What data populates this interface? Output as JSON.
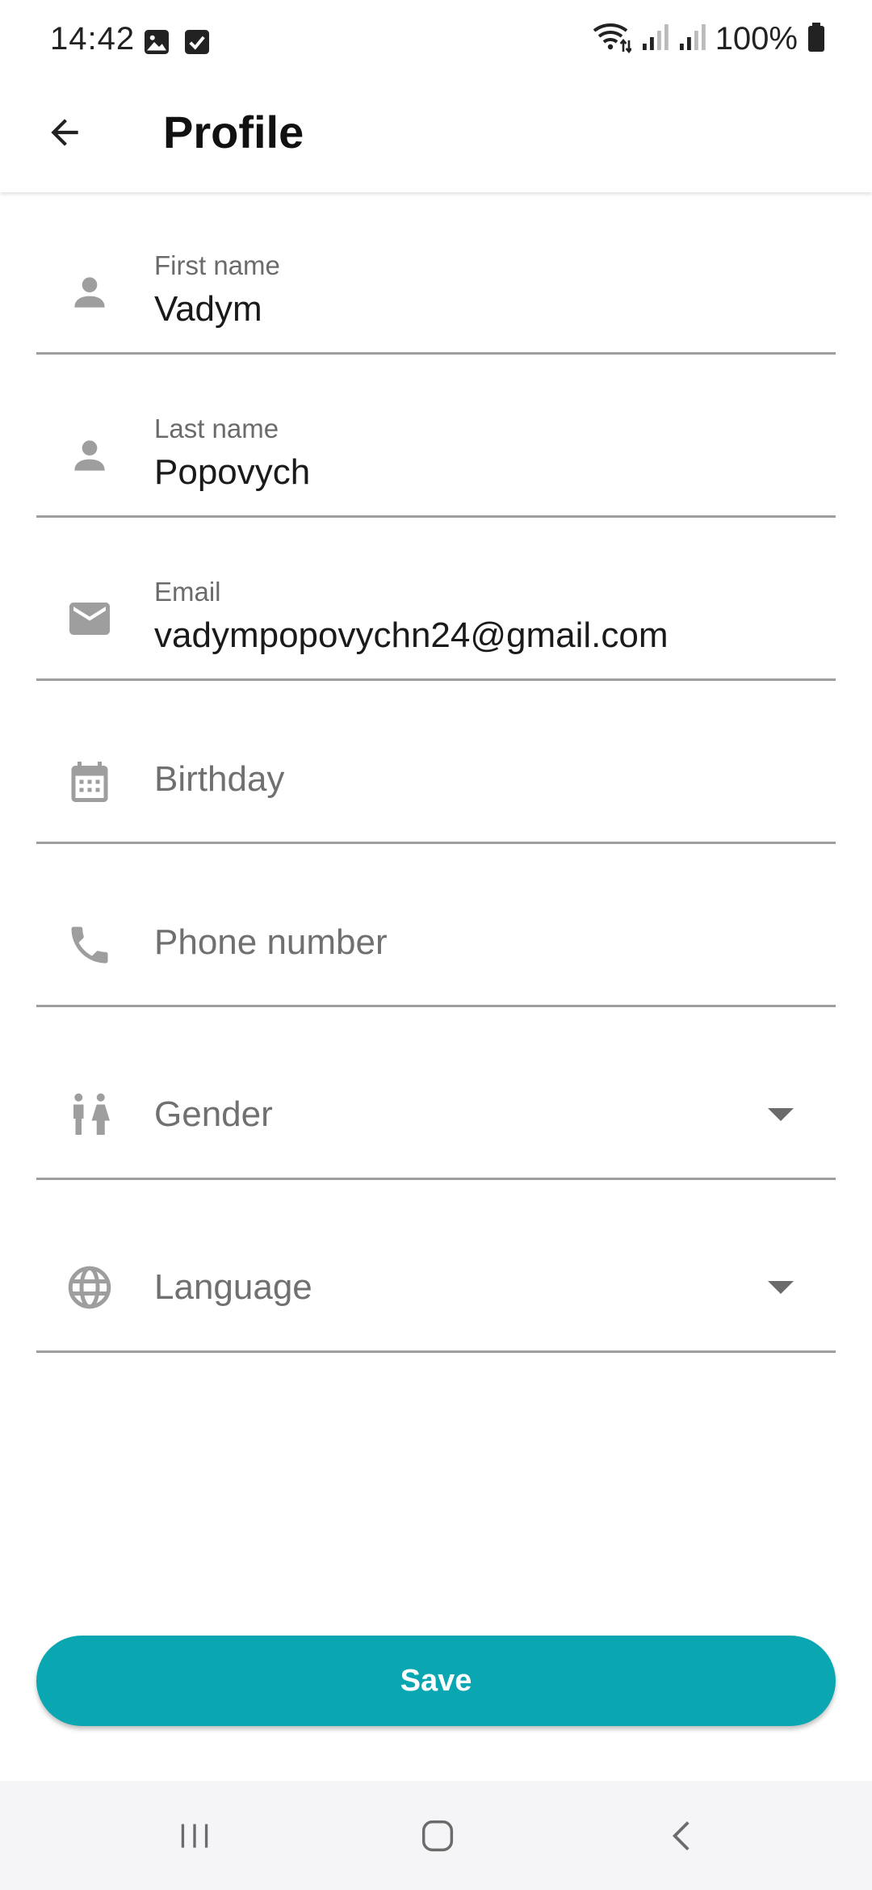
{
  "status_bar": {
    "time": "14:42",
    "battery": "100%"
  },
  "app_bar": {
    "title": "Profile"
  },
  "fields": {
    "first_name": {
      "label": "First name",
      "value": "Vadym",
      "icon": "person-icon"
    },
    "last_name": {
      "label": "Last name",
      "value": "Popovych",
      "icon": "person-icon"
    },
    "email": {
      "label": "Email",
      "value": "vadympopovychn24@gmail.com",
      "icon": "mail-icon"
    },
    "birthday": {
      "placeholder": "Birthday",
      "icon": "calendar-icon"
    },
    "phone": {
      "placeholder": "Phone number",
      "icon": "phone-icon"
    },
    "gender": {
      "placeholder": "Gender",
      "icon": "gender-icon"
    },
    "language": {
      "placeholder": "Language",
      "icon": "globe-icon"
    }
  },
  "actions": {
    "save_label": "Save"
  },
  "colors": {
    "accent": "#0aa6b2",
    "icon_gray": "#9e9e9e",
    "divider": "#9e9e9e"
  }
}
